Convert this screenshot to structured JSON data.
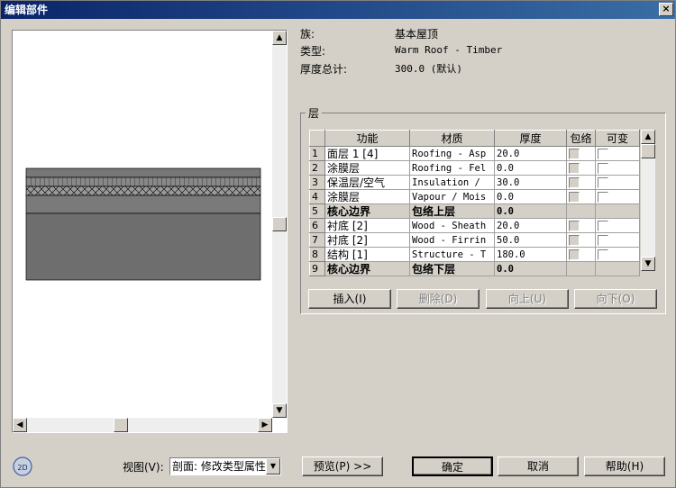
{
  "window": {
    "title": "编辑部件",
    "close_glyph": "×"
  },
  "info": {
    "family_label": "族:",
    "family_value": "基本屋顶",
    "type_label": "类型:",
    "type_value": "Warm Roof - Timber",
    "thickness_label": "厚度总计:",
    "thickness_value": "300.0 (默认)"
  },
  "layers_group": {
    "title": "层",
    "columns": [
      "",
      "功能",
      "材质",
      "厚度",
      "包络",
      "可变"
    ],
    "rows": [
      {
        "num": "1",
        "function": "面层 1 [4]",
        "material": "Roofing - Asp",
        "thickness": "20.0",
        "wrap": true,
        "variable": true,
        "core": false
      },
      {
        "num": "2",
        "function": "涂膜层",
        "material": "Roofing - Fel",
        "thickness": "0.0",
        "wrap": true,
        "variable": true,
        "core": false
      },
      {
        "num": "3",
        "function": "保温层/空气",
        "material": "Insulation /",
        "thickness": "30.0",
        "wrap": true,
        "variable": true,
        "core": false
      },
      {
        "num": "4",
        "function": "涂膜层",
        "material": "Vapour / Mois",
        "thickness": "0.0",
        "wrap": true,
        "variable": true,
        "core": false
      },
      {
        "num": "5",
        "function": "核心边界",
        "material": "包络上层",
        "thickness": "0.0",
        "wrap": false,
        "variable": false,
        "core": true
      },
      {
        "num": "6",
        "function": "衬底 [2]",
        "material": "Wood - Sheath",
        "thickness": "20.0",
        "wrap": true,
        "variable": true,
        "core": false
      },
      {
        "num": "7",
        "function": "衬底 [2]",
        "material": "Wood - Firrin",
        "thickness": "50.0",
        "wrap": true,
        "variable": true,
        "core": false
      },
      {
        "num": "8",
        "function": "结构 [1]",
        "material": "Structure - T",
        "thickness": "180.0",
        "wrap": true,
        "variable": true,
        "core": false
      },
      {
        "num": "9",
        "function": "核心边界",
        "material": "包络下层",
        "thickness": "0.0",
        "wrap": false,
        "variable": false,
        "core": true
      }
    ],
    "buttons": {
      "insert": "插入(I)",
      "delete": "删除(D)",
      "up": "向上(U)",
      "down": "向下(O)"
    }
  },
  "bottom": {
    "view_label": "视图(V):",
    "view_value": "剖面: 修改类型属性",
    "preview_button": "预览(P) >>",
    "ok": "确定",
    "cancel": "取消",
    "help": "帮助(H)",
    "toggle_2d_text": "2D"
  },
  "scroll": {
    "preview_v": 0.5,
    "preview_h": 0.4,
    "table_v": 0.0
  }
}
